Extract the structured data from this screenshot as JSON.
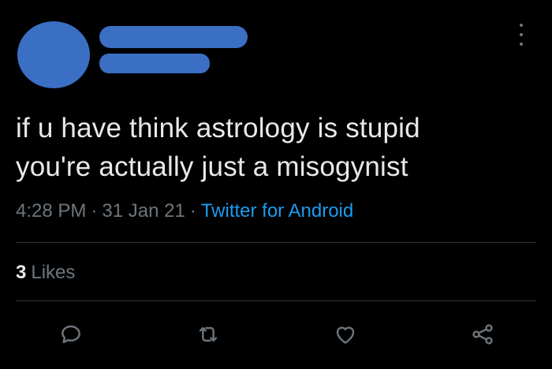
{
  "author": {
    "avatar_color": "#3a6fc4",
    "name_redacted_color": "#3a6fc4"
  },
  "tweet": {
    "text_line1": "if u have think astrology is stupid",
    "text_line2": "you're actually just a misogynist",
    "time": "4:28 PM",
    "date": "31 Jan 21",
    "separator": "·",
    "source": "Twitter for Android"
  },
  "stats": {
    "likes_count": "3",
    "likes_label": "Likes"
  },
  "actions": {
    "reply_icon": "reply-icon",
    "retweet_icon": "retweet-icon",
    "like_icon": "heart-icon",
    "share_icon": "share-icon"
  },
  "colors": {
    "background": "#000000",
    "text": "#e7e9ea",
    "muted": "#6e767d",
    "link": "#1d9bf0",
    "divider": "#2f3336"
  }
}
